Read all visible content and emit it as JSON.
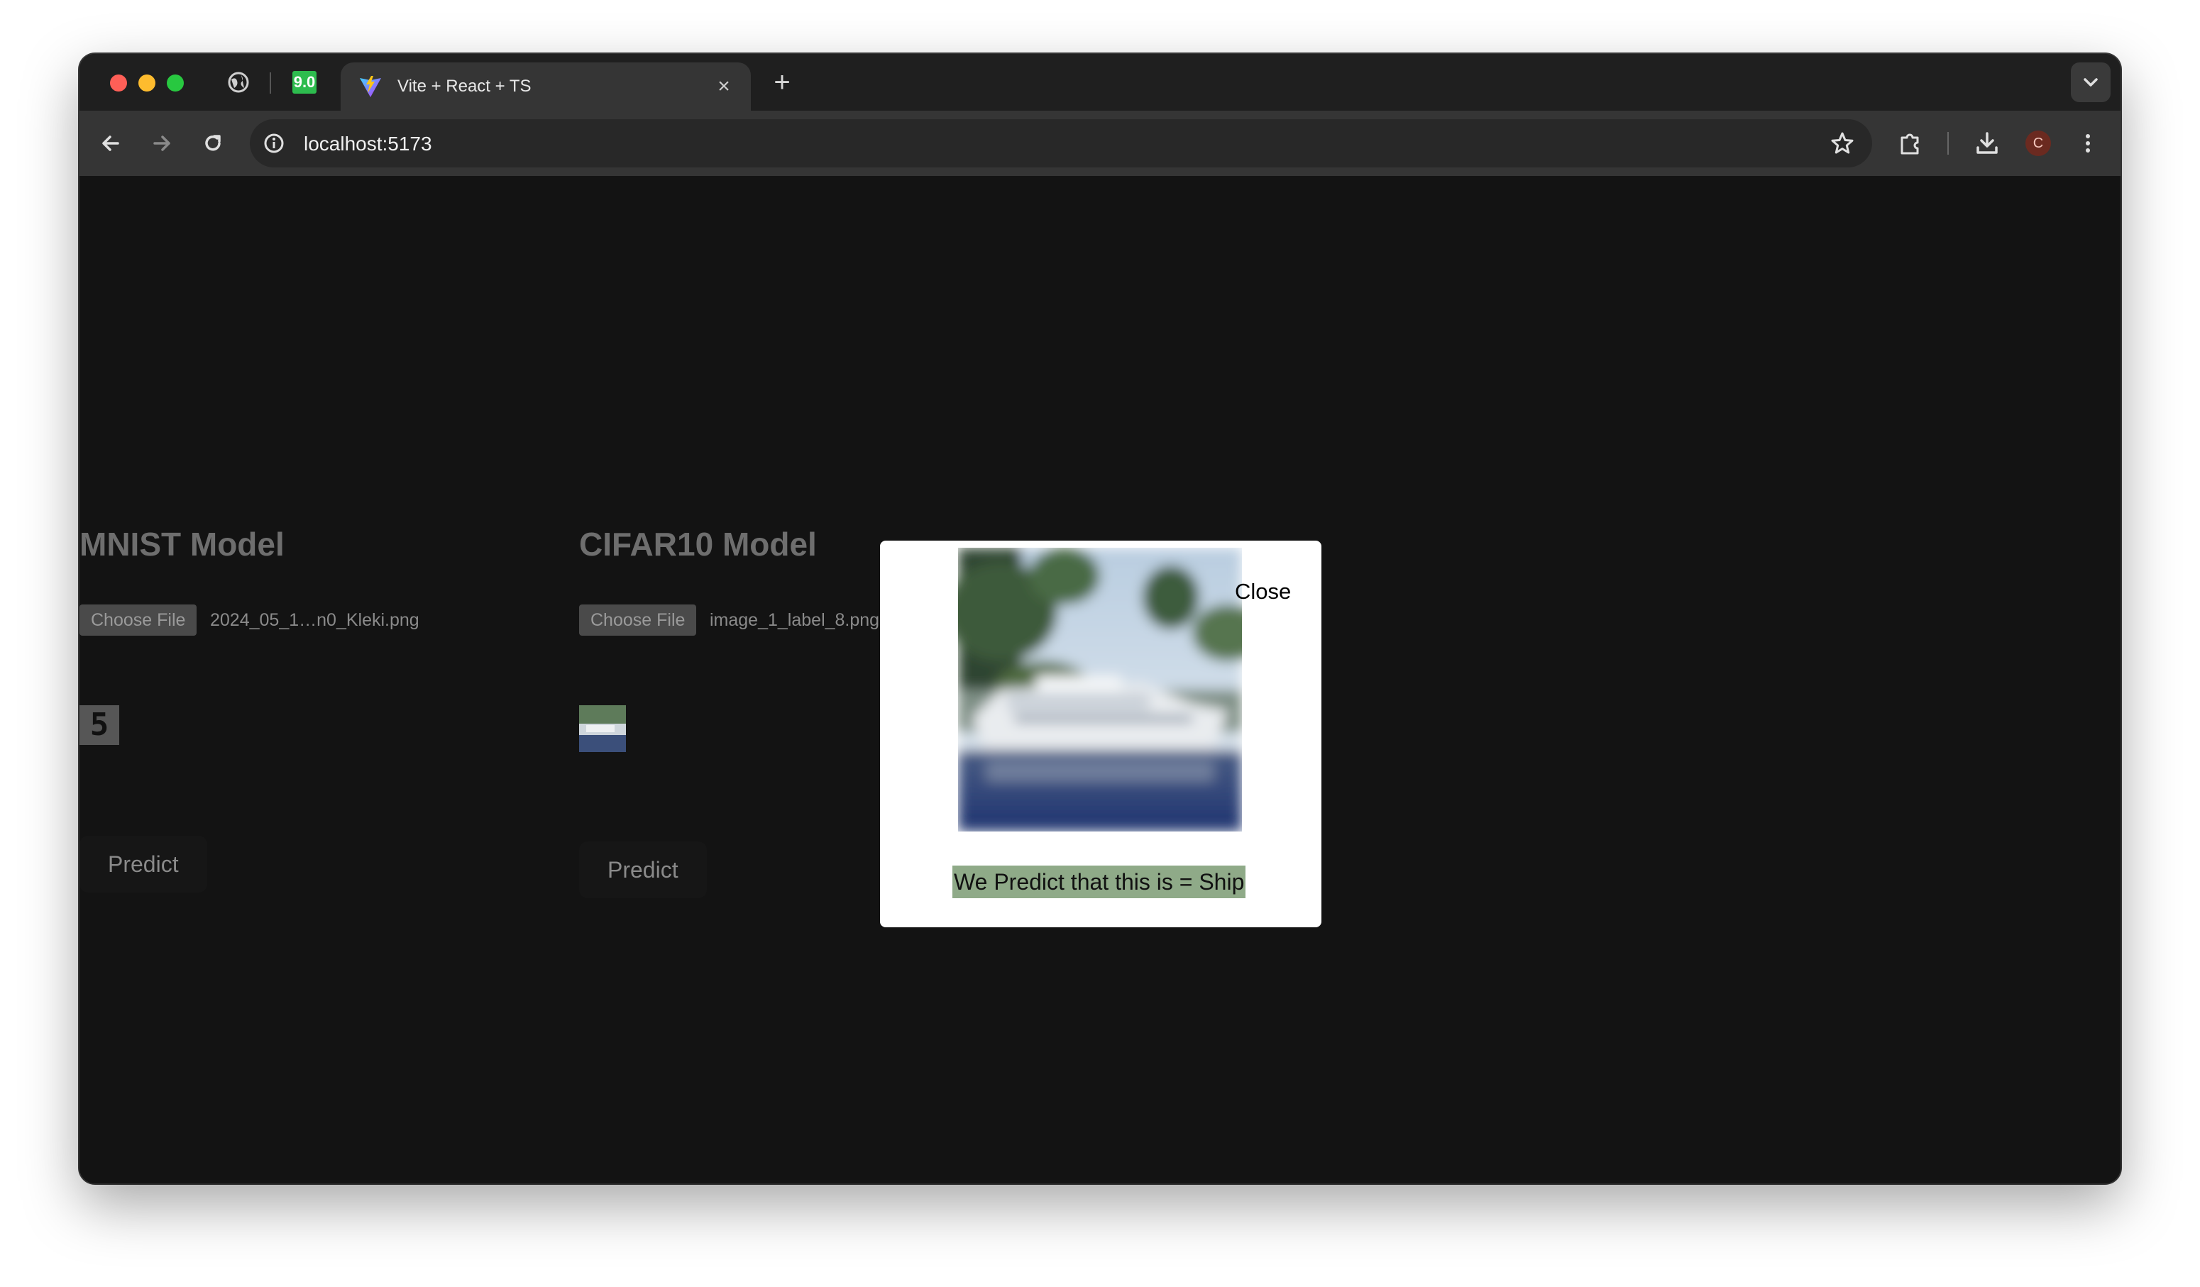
{
  "browser": {
    "pinned_badge_text": "9.0",
    "tab": {
      "title": "Vite + React + TS",
      "close_label": "×"
    },
    "new_tab_label": "+",
    "url": "localhost:5173",
    "profile_initial": "C"
  },
  "models": [
    {
      "title": "MNIST Model",
      "choose_label": "Choose File",
      "file_name": "2024_05_1…n0_Kleki.png",
      "thumb_digit": "5",
      "predict_label": "Predict"
    },
    {
      "title": "CIFAR10 Model",
      "choose_label": "Choose File",
      "file_name": "image_1_label_8.png",
      "predict_label": "Predict"
    }
  ],
  "modal": {
    "close_label": "Close",
    "prediction_text": "We Predict that this is = Ship"
  },
  "colors": {
    "page_background": "#131313",
    "tab_strip": "#1f1f1f",
    "toolbar": "#353535",
    "prediction_highlight": "#8faa88"
  },
  "icons": {
    "tab_favicon": "vite-logo-icon",
    "back": "arrow-left-icon",
    "forward": "arrow-right-icon",
    "reload": "reload-icon",
    "site_info": "info-icon",
    "bookmark": "star-icon",
    "extensions": "puzzle-icon",
    "downloads": "download-icon",
    "menu": "kebab-menu-icon"
  }
}
